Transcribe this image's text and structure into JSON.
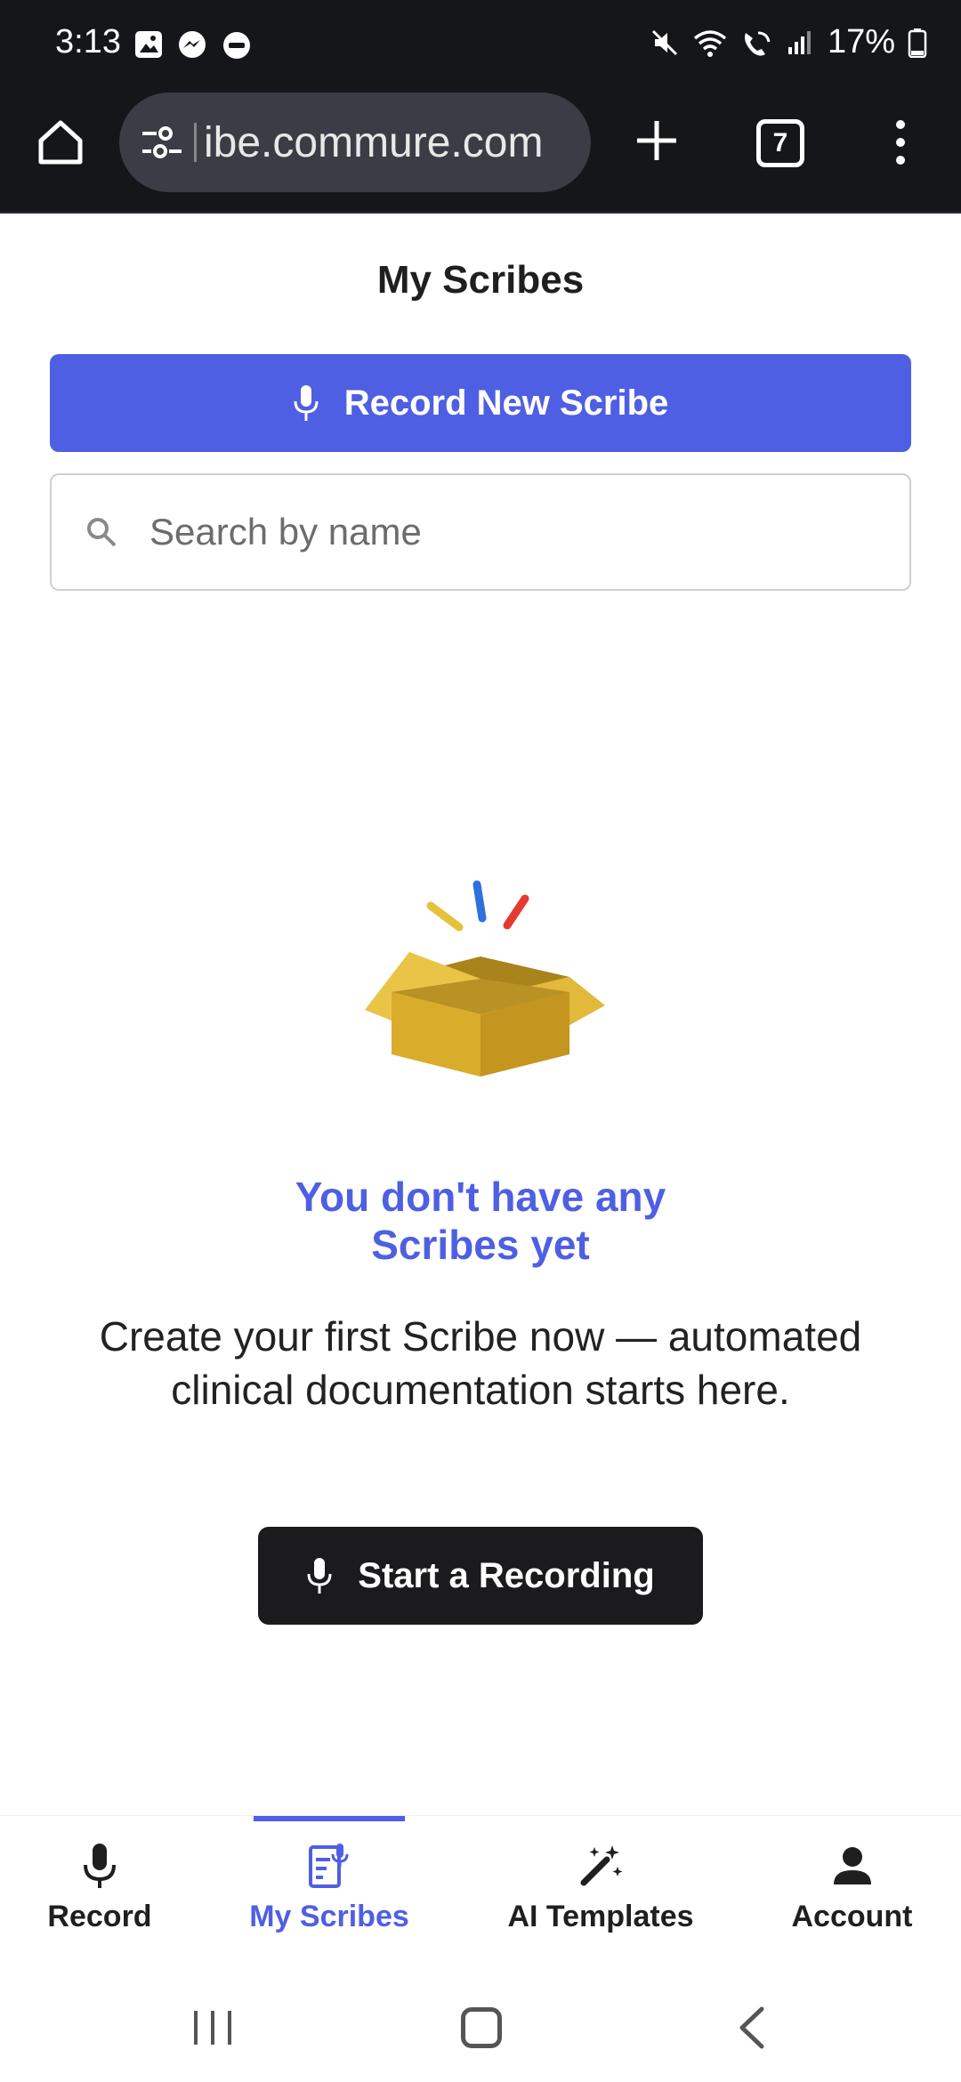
{
  "status_bar": {
    "time": "3:13",
    "battery": "17%",
    "left_icons": [
      "image-icon",
      "messenger-icon",
      "dnd-icon"
    ],
    "right_icons": [
      "mute-icon",
      "wifi-icon",
      "wifi-call-icon",
      "signal-icon",
      "battery-icon"
    ]
  },
  "browser": {
    "url": "ibe.commure.com",
    "tab_count": "7",
    "icons": [
      "home-icon",
      "site-settings-icon",
      "new-tab-icon",
      "tabs-icon",
      "more-menu-icon"
    ]
  },
  "page": {
    "title": "My Scribes",
    "record_new_label": "Record New Scribe",
    "search_placeholder": "Search by name",
    "empty_title_line1": "You don't have any",
    "empty_title_line2": "Scribes yet",
    "empty_desc_line1": "Create your first Scribe now — automated",
    "empty_desc_line2": "clinical documentation starts here.",
    "start_recording_label": "Start a Recording"
  },
  "bottom_nav": {
    "items": [
      {
        "label": "Record",
        "icon": "microphone-icon",
        "active": false
      },
      {
        "label": "My Scribes",
        "icon": "scribes-icon",
        "active": true
      },
      {
        "label": "AI Templates",
        "icon": "magic-wand-icon",
        "active": false
      },
      {
        "label": "Account",
        "icon": "person-icon",
        "active": false
      }
    ]
  },
  "colors": {
    "accent": "#4f5fe3",
    "dark_button": "#1b1b1d",
    "status_bar_bg": "#15161a"
  }
}
